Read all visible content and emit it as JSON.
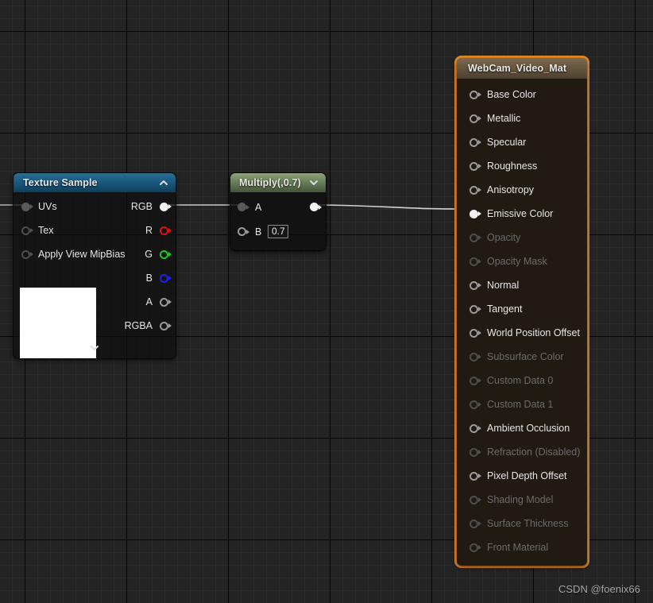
{
  "canvas": {
    "background_color": "#242424",
    "grid_minor_color": "#2d2d2d",
    "grid_major_color": "#0a0a0a"
  },
  "watermark": {
    "text": "CSDN @foenix66"
  },
  "material_node": {
    "title": "WebCam_Video_Mat",
    "selected": true,
    "selection_color": "#f0922b",
    "header_color": "#67573f",
    "pins": [
      {
        "label": "Base Color",
        "state": "enabled",
        "connected": false
      },
      {
        "label": "Metallic",
        "state": "enabled",
        "connected": false
      },
      {
        "label": "Specular",
        "state": "enabled",
        "connected": false
      },
      {
        "label": "Roughness",
        "state": "enabled",
        "connected": false
      },
      {
        "label": "Anisotropy",
        "state": "enabled",
        "connected": false
      },
      {
        "label": "Emissive Color",
        "state": "enabled",
        "connected": true
      },
      {
        "label": "Opacity",
        "state": "disabled",
        "connected": false
      },
      {
        "label": "Opacity Mask",
        "state": "disabled",
        "connected": false
      },
      {
        "label": "Normal",
        "state": "enabled",
        "connected": false
      },
      {
        "label": "Tangent",
        "state": "enabled",
        "connected": false
      },
      {
        "label": "World Position Offset",
        "state": "enabled",
        "connected": false
      },
      {
        "label": "Subsurface Color",
        "state": "disabled",
        "connected": false
      },
      {
        "label": "Custom Data 0",
        "state": "disabled",
        "connected": false
      },
      {
        "label": "Custom Data 1",
        "state": "disabled",
        "connected": false
      },
      {
        "label": "Ambient Occlusion",
        "state": "enabled",
        "connected": false
      },
      {
        "label": "Refraction (Disabled)",
        "state": "disabled",
        "connected": false
      },
      {
        "label": "Pixel Depth Offset",
        "state": "enabled",
        "connected": false
      },
      {
        "label": "Shading Model",
        "state": "disabled",
        "connected": false
      },
      {
        "label": "Surface Thickness",
        "state": "disabled",
        "connected": false
      },
      {
        "label": "Front Material",
        "state": "disabled",
        "connected": false
      }
    ]
  },
  "texture_sample_node": {
    "title": "Texture Sample",
    "header_color": "#1d5f84",
    "collapse_icon": "chevron-up-icon",
    "expander_icon": "chevron-down-icon",
    "inputs": [
      {
        "label": "UVs",
        "pin_style": "gray-filled",
        "connected": true
      },
      {
        "label": "Tex",
        "pin_style": "dim",
        "connected": false
      },
      {
        "label": "Apply View MipBias",
        "pin_style": "dim",
        "connected": false
      }
    ],
    "outputs": [
      {
        "label": "RGB",
        "pin_style": "filled",
        "color": "#f2f2f2",
        "connected": true
      },
      {
        "label": "R",
        "pin_style": "red",
        "color": "#e01010",
        "connected": false
      },
      {
        "label": "G",
        "pin_style": "green",
        "color": "#18cc18",
        "connected": false
      },
      {
        "label": "B",
        "pin_style": "blue",
        "color": "#1b22ef",
        "connected": false
      },
      {
        "label": "A",
        "pin_style": "normal",
        "color": "#9a9a9a",
        "connected": false
      },
      {
        "label": "RGBA",
        "pin_style": "normal",
        "color": "#9a9a9a",
        "connected": false
      }
    ],
    "preview": {
      "color": "#ffffff"
    }
  },
  "multiply_node": {
    "title": "Multiply(,0.7)",
    "header_color": "#6d855c",
    "collapse_icon": "chevron-down-icon",
    "input_a": {
      "label": "A",
      "pin_style": "gray-filled",
      "connected": true
    },
    "input_b": {
      "label": "B",
      "pin_style": "normal",
      "connected": false,
      "value": "0.7"
    },
    "output": {
      "pin_style": "filled",
      "connected": true
    }
  },
  "connections": [
    {
      "from": "offscreen-left",
      "to": "texture-sample.UVs",
      "color": "#cfcfcf"
    },
    {
      "from": "texture-sample.RGB",
      "to": "multiply.A",
      "color": "#dcdcdc"
    },
    {
      "from": "multiply.out",
      "to": "material.Emissive Color",
      "color": "#e6e6e6"
    }
  ]
}
